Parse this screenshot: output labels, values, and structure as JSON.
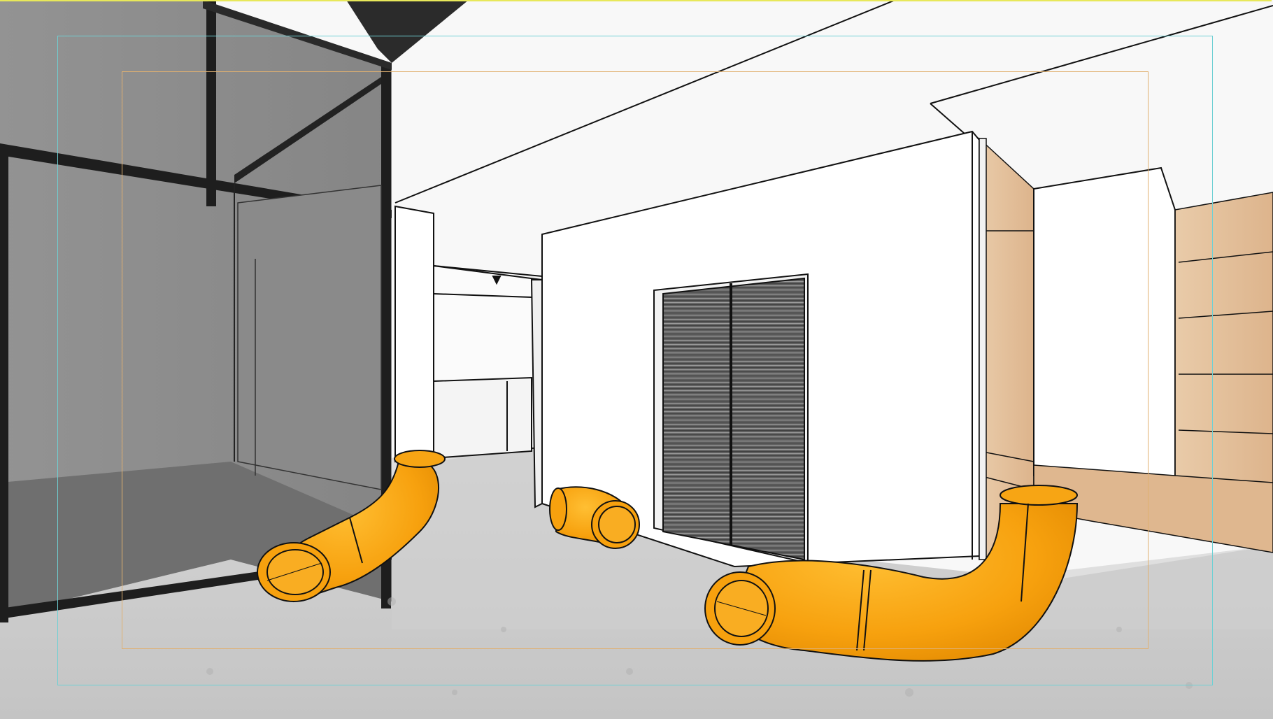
{
  "viewport": {
    "colors": {
      "background": "#f8f8f8",
      "floor": "#c9c9c9",
      "floor_light": "#dcdcdc",
      "glass": "#8f8f8f",
      "glass_dark": "#6e6e6e",
      "frame": "#1e1e1e",
      "wood": "#e7c6a4",
      "wood_dark": "#c9a07a",
      "door": "#5c5c5c",
      "seat": "#f5a20f",
      "seat_dark": "#d98400",
      "seat_light": "#ffc23a",
      "line": "#111111",
      "safe_frame_outer": "#6fd0d4",
      "safe_frame_inner": "#e0b070",
      "top_border": "#e8e85a"
    },
    "guides": [
      "render-region-frame",
      "action-safe-frame",
      "title-safe-frame"
    ]
  }
}
